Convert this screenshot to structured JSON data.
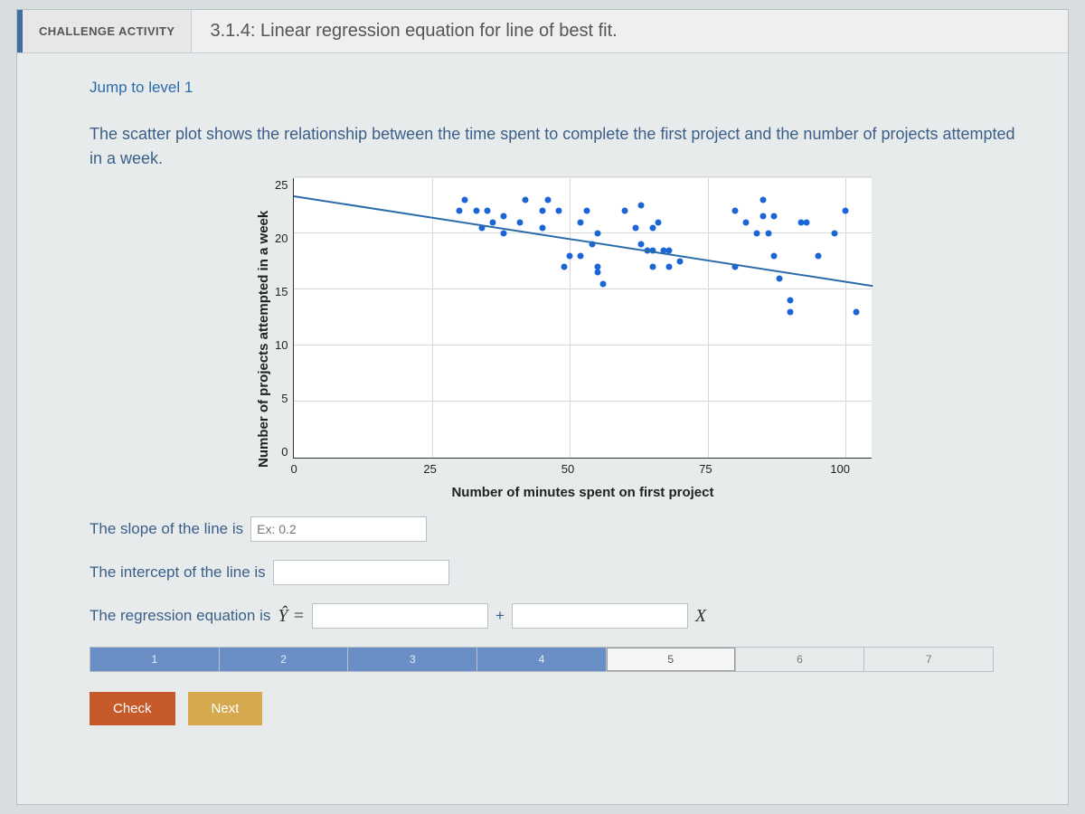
{
  "header": {
    "badge": "CHALLENGE ACTIVITY",
    "title": "3.1.4: Linear regression equation for line of best fit."
  },
  "jump_link": "Jump to level 1",
  "prompt": "The scatter plot shows the relationship between the time spent to complete the first project and the number of projects attempted in a week.",
  "chart_data": {
    "type": "scatter",
    "xlabel": "Number of minutes spent on first project",
    "ylabel": "Number of projects attempted in a week",
    "xlim": [
      0,
      105
    ],
    "ylim": [
      0,
      25
    ],
    "xticks": [
      0,
      25,
      50,
      75,
      100
    ],
    "yticks": [
      0,
      5,
      10,
      15,
      20,
      25
    ],
    "regression": {
      "x1": 0,
      "y1": 23.5,
      "x2": 105,
      "y2": 15.5
    },
    "points": [
      {
        "x": 30,
        "y": 22
      },
      {
        "x": 31,
        "y": 23
      },
      {
        "x": 33,
        "y": 22
      },
      {
        "x": 35,
        "y": 22
      },
      {
        "x": 34,
        "y": 20.5
      },
      {
        "x": 36,
        "y": 21
      },
      {
        "x": 38,
        "y": 21.5
      },
      {
        "x": 38,
        "y": 20
      },
      {
        "x": 41,
        "y": 21
      },
      {
        "x": 42,
        "y": 23
      },
      {
        "x": 45,
        "y": 22
      },
      {
        "x": 45,
        "y": 20.5
      },
      {
        "x": 46,
        "y": 23
      },
      {
        "x": 48,
        "y": 22
      },
      {
        "x": 52,
        "y": 21
      },
      {
        "x": 53,
        "y": 22
      },
      {
        "x": 55,
        "y": 20
      },
      {
        "x": 49,
        "y": 17
      },
      {
        "x": 50,
        "y": 18
      },
      {
        "x": 52,
        "y": 18
      },
      {
        "x": 54,
        "y": 19
      },
      {
        "x": 55,
        "y": 17
      },
      {
        "x": 56,
        "y": 15.5
      },
      {
        "x": 55,
        "y": 16.5
      },
      {
        "x": 60,
        "y": 22
      },
      {
        "x": 62,
        "y": 20.5
      },
      {
        "x": 63,
        "y": 22.5
      },
      {
        "x": 63,
        "y": 19
      },
      {
        "x": 65,
        "y": 20.5
      },
      {
        "x": 66,
        "y": 21
      },
      {
        "x": 64,
        "y": 18.5
      },
      {
        "x": 65,
        "y": 18.5
      },
      {
        "x": 67,
        "y": 18.5
      },
      {
        "x": 68,
        "y": 18.5
      },
      {
        "x": 65,
        "y": 17
      },
      {
        "x": 68,
        "y": 17
      },
      {
        "x": 70,
        "y": 17.5
      },
      {
        "x": 80,
        "y": 22
      },
      {
        "x": 82,
        "y": 21
      },
      {
        "x": 80,
        "y": 17
      },
      {
        "x": 84,
        "y": 20
      },
      {
        "x": 85,
        "y": 21.5
      },
      {
        "x": 85,
        "y": 23
      },
      {
        "x": 86,
        "y": 20
      },
      {
        "x": 87,
        "y": 21.5
      },
      {
        "x": 87,
        "y": 18
      },
      {
        "x": 88,
        "y": 16
      },
      {
        "x": 90,
        "y": 14
      },
      {
        "x": 90,
        "y": 13
      },
      {
        "x": 92,
        "y": 21
      },
      {
        "x": 93,
        "y": 21
      },
      {
        "x": 95,
        "y": 18
      },
      {
        "x": 98,
        "y": 20
      },
      {
        "x": 100,
        "y": 22
      },
      {
        "x": 102,
        "y": 13
      }
    ]
  },
  "inputs": {
    "slope_label": "The slope of the line is",
    "slope_placeholder": "Ex: 0.2",
    "intercept_label": "The intercept of the line is",
    "equation_label": "The regression equation is",
    "yhat": "Ŷ =",
    "plus": "+",
    "x_var": "X"
  },
  "progress": {
    "segments": [
      "1",
      "2",
      "3",
      "4",
      "5",
      "6",
      "7"
    ],
    "filled_upto": 4,
    "current": 5
  },
  "buttons": {
    "check": "Check",
    "next": "Next"
  }
}
